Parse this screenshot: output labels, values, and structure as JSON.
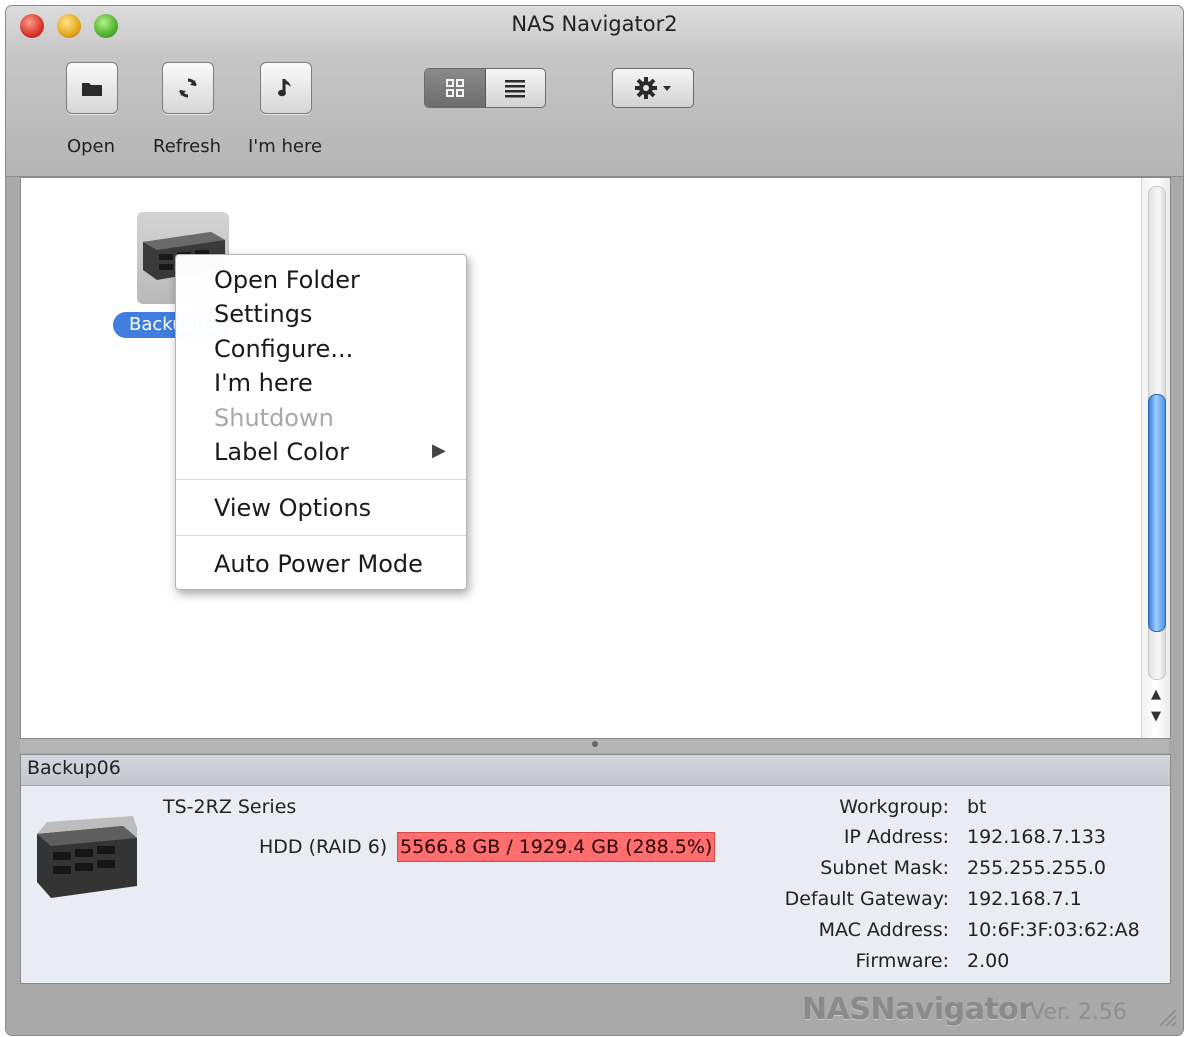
{
  "window": {
    "title": "NAS Navigator2"
  },
  "toolbar": {
    "open_label": "Open",
    "refresh_label": "Refresh",
    "imhere_label": "I'm here"
  },
  "device": {
    "short_label": "Backup06",
    "icon": "nas-device-icon"
  },
  "context_menu": {
    "items": [
      {
        "label": "Open Folder",
        "enabled": true
      },
      {
        "label": "Settings",
        "enabled": true
      },
      {
        "label": "Configure...",
        "enabled": true
      },
      {
        "label": "I'm here",
        "enabled": true
      },
      {
        "label": "Shutdown",
        "enabled": false
      },
      {
        "label": "Label Color",
        "enabled": true,
        "submenu": true
      },
      {
        "label": "View Options",
        "enabled": true
      },
      {
        "label": "Auto Power Mode",
        "enabled": true
      }
    ]
  },
  "info_panel": {
    "device_name": "Backup06",
    "model": "TS-2RZ Series",
    "hdd_label": "HDD (RAID 6)",
    "hdd_value": "5566.8 GB / 1929.4 GB (288.5%)",
    "hdd_highlight_color": "#ff6e6e",
    "fields": [
      {
        "key": "Workgroup:",
        "value": "bt"
      },
      {
        "key": "IP Address:",
        "value": "192.168.7.133"
      },
      {
        "key": "Subnet Mask:",
        "value": "255.255.255.0"
      },
      {
        "key": "Default Gateway:",
        "value": "192.168.7.1"
      },
      {
        "key": "MAC Address:",
        "value": "10:6F:3F:03:62:A8"
      },
      {
        "key": "Firmware:",
        "value": "2.00"
      }
    ]
  },
  "footer": {
    "brand": "NASNavigator",
    "version": "Ver. 2.56"
  },
  "colors": {
    "selection_blue": "#3f7ddf",
    "scroll_thumb": "#4d93e6"
  }
}
